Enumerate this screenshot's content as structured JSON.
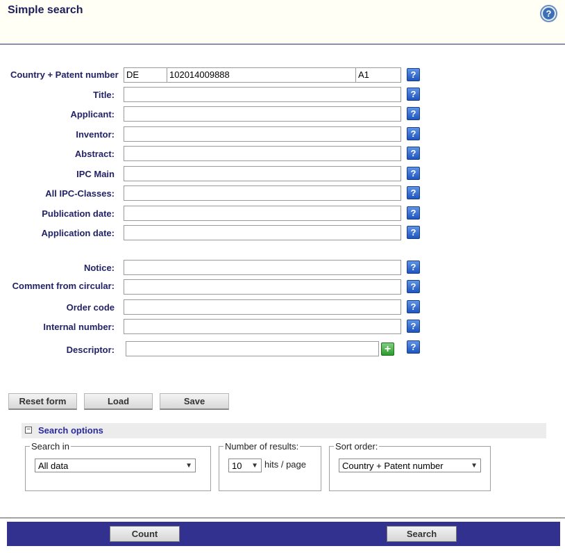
{
  "header": {
    "title": "Simple search",
    "help_icon": "help-icon"
  },
  "patent": {
    "label": "Country + Patent number",
    "country": "DE",
    "number": "102014009888",
    "kind": "A1"
  },
  "fields": [
    {
      "id": "title",
      "label": "Title:",
      "value": ""
    },
    {
      "id": "applicant",
      "label": "Applicant:",
      "value": ""
    },
    {
      "id": "inventor",
      "label": "Inventor:",
      "value": ""
    },
    {
      "id": "abstract",
      "label": "Abstract:",
      "value": ""
    },
    {
      "id": "ipc-main",
      "label": "IPC Main",
      "value": ""
    },
    {
      "id": "all-ipc",
      "label": "All IPC-Classes:",
      "value": ""
    },
    {
      "id": "pub-date",
      "label": "Publication date:",
      "value": ""
    },
    {
      "id": "app-date",
      "label": "Application date:",
      "value": ""
    },
    {
      "id": "notice",
      "label": "Notice:",
      "value": ""
    },
    {
      "id": "comment",
      "label": "Comment from circular:",
      "value": ""
    },
    {
      "id": "order-code",
      "label": "Order code",
      "value": ""
    },
    {
      "id": "internal-number",
      "label": "Internal number:",
      "value": ""
    },
    {
      "id": "descriptor",
      "label": "Descriptor:",
      "value": ""
    }
  ],
  "actions": {
    "reset": "Reset form",
    "load": "Load",
    "save": "Save"
  },
  "options": {
    "title": "Search options",
    "toggle_symbol": "⊟",
    "search_in": {
      "legend": "Search in",
      "selected": "All data"
    },
    "results": {
      "legend": "Number of results:",
      "selected": "10",
      "suffix": "hits / page"
    },
    "sort": {
      "legend": "Sort order:",
      "selected": "Country + Patent number"
    }
  },
  "footer": {
    "count": "Count",
    "search": "Search"
  },
  "colors": {
    "accent": "#32318f",
    "label": "#222266",
    "help": "#1f55c0"
  }
}
